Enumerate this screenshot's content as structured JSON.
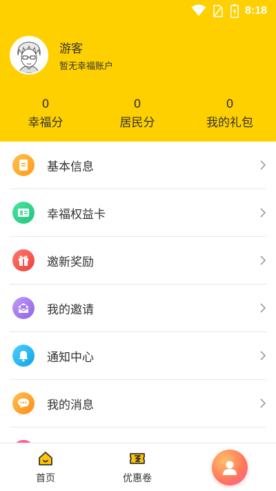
{
  "status_bar": {
    "time": "8:18"
  },
  "profile": {
    "username": "游客",
    "account_status": "暂无幸福账户"
  },
  "stats": [
    {
      "value": "0",
      "label": "幸福分"
    },
    {
      "value": "0",
      "label": "居民分"
    },
    {
      "value": "0",
      "label": "我的礼包"
    }
  ],
  "menu": [
    {
      "label": "基本信息",
      "icon": "document-icon",
      "color": "#FFA51F"
    },
    {
      "label": "幸福权益卡",
      "icon": "id-card-icon",
      "color": "#2BD38B"
    },
    {
      "label": "邀新奖励",
      "icon": "gift-icon",
      "color": "#F4584F"
    },
    {
      "label": "我的邀请",
      "icon": "envelope-icon",
      "color": "#A77BF0"
    },
    {
      "label": "通知中心",
      "icon": "bell-icon",
      "color": "#1FB6F2"
    },
    {
      "label": "我的消息",
      "icon": "chat-bubble-icon",
      "color": "#FF9F2E"
    }
  ],
  "bottom_nav": [
    {
      "label": "首页",
      "icon": "home-icon"
    },
    {
      "label": "优惠卷",
      "icon": "coupon-icon"
    }
  ],
  "colors": {
    "header_bg": "#FFD000",
    "nav_icon_fill": "#FFC300"
  }
}
